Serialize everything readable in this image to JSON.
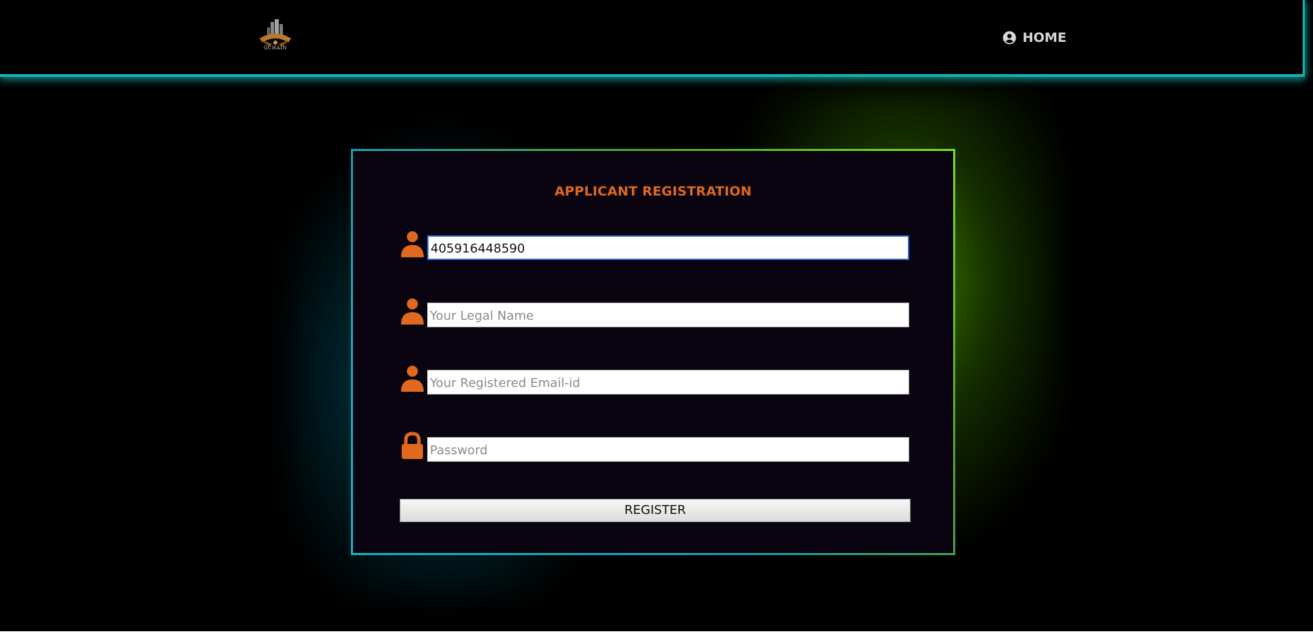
{
  "header": {
    "logo_text": "GCHAIN",
    "home_label": "HOME",
    "home_icon": "user-circle-icon"
  },
  "form": {
    "title": "APPLICANT REGISTRATION",
    "fields": [
      {
        "icon": "user-icon",
        "value": "405916448590",
        "placeholder": ""
      },
      {
        "icon": "user-icon",
        "value": "",
        "placeholder": "Your Legal Name"
      },
      {
        "icon": "user-icon",
        "value": "",
        "placeholder": "Your Registered Email-id"
      },
      {
        "icon": "lock-icon",
        "value": "",
        "placeholder": "Password"
      }
    ],
    "submit_label": "REGISTER"
  },
  "colors": {
    "accent": "#e0691f",
    "navbar_border": "#17b3b3",
    "glow_cyan": "#0fb8c7",
    "glow_green": "#7de01a",
    "card_background": "#0a0410"
  }
}
